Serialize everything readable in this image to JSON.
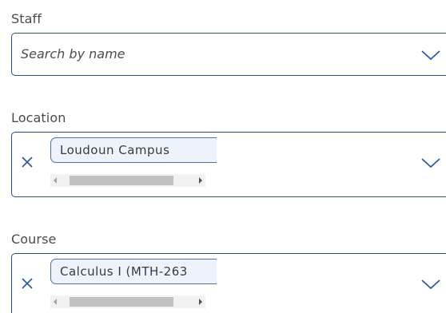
{
  "staff": {
    "label": "Staff",
    "placeholder": "Search by name"
  },
  "location": {
    "label": "Location",
    "selected_chip": "Loudoun Campus"
  },
  "course": {
    "label": "Course",
    "selected_chip": "Calculus I (MTH-263"
  },
  "icons": {
    "dropdown": "chevron-down-icon",
    "clear": "close-icon"
  },
  "colors": {
    "border": "#2b4f86",
    "chip_bg": "#edf3fb",
    "icon_blue": "#2b5ca8"
  }
}
